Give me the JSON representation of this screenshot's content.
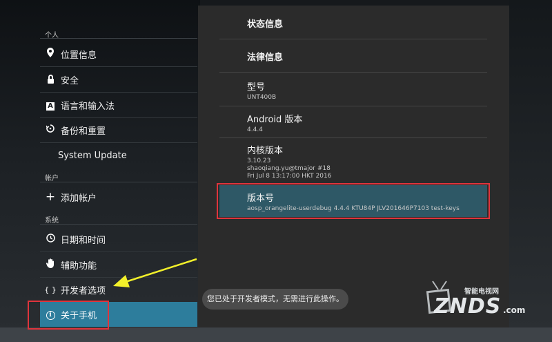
{
  "sidebar": {
    "section_personal": "个人",
    "section_accounts": "帐户",
    "section_system": "系统",
    "items": [
      {
        "label": "位置信息",
        "icon": "location-pin-icon"
      },
      {
        "label": "安全",
        "icon": "lock-icon"
      },
      {
        "label": "语言和输入法",
        "icon": "language-a-icon"
      },
      {
        "label": "备份和重置",
        "icon": "backup-restore-icon"
      },
      {
        "label": "System Update",
        "icon": ""
      },
      {
        "label": "添加帐户",
        "icon": "plus-icon"
      },
      {
        "label": "日期和时间",
        "icon": "clock-icon"
      },
      {
        "label": "辅助功能",
        "icon": "hand-icon"
      },
      {
        "label": "开发者选项",
        "icon": "braces-icon",
        "glyph": "{ }"
      },
      {
        "label": "关于手机",
        "icon": "info-icon",
        "glyph": "i",
        "selected": true
      }
    ]
  },
  "detail": {
    "status_info": "状态信息",
    "legal_info": "法律信息",
    "model_title": "型号",
    "model_value": "UNT400B",
    "android_title": "Android 版本",
    "android_value": "4.4.4",
    "kernel_title": "内核版本",
    "kernel_line1": "3.10.23",
    "kernel_line2": "shaoqiang.yu@tmajor #18",
    "kernel_line3": "Fri Jul 8 13:17:00 HKT 2016",
    "build_title": "版本号",
    "build_value": "aosp_orangelite-userdebug 4.4.4 KTU84P JLV201646P7103 test-keys"
  },
  "toast": "您已处于开发者模式，无需进行此操作。",
  "watermark": {
    "top_text": "智能电视网",
    "brand": "ZNDS",
    "suffix": ".com"
  },
  "colors": {
    "selected": "#2d7d9c",
    "build_highlight": "#2e5866",
    "red_box": "#e0343c",
    "arrow": "#f2f02a"
  }
}
